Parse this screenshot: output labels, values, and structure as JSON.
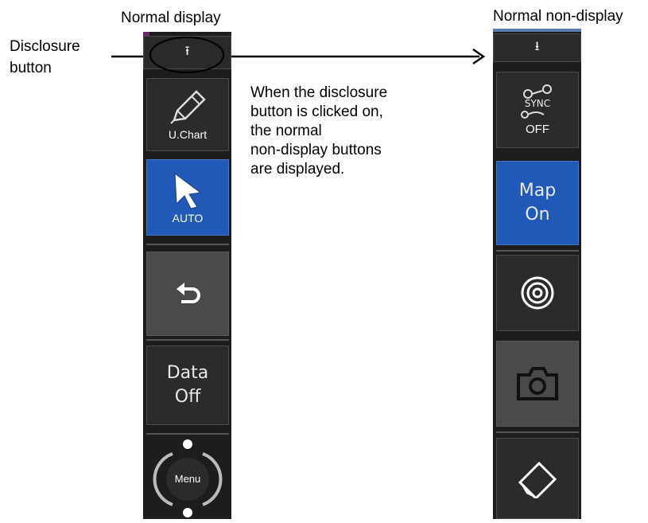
{
  "labels": {
    "normal_display": "Normal display",
    "normal_non_display": "Normal non-display",
    "disclosure_button_line1": "Disclosure",
    "disclosure_button_line2": "button",
    "note_lines": [
      "When the disclosure",
      "button is clicked on,",
      "the normal",
      "non-display buttons",
      "are displayed."
    ]
  },
  "left_panel": {
    "disclosure_glyph": "⭱",
    "uchart_label": "U.Chart",
    "auto_label": "AUTO",
    "data_line1": "Data",
    "data_line2": "Off",
    "menu_label": "Menu"
  },
  "right_panel": {
    "disclosure_glyph": "⭳",
    "sync_line1": "SYNC",
    "sync_line2": "OFF",
    "map_line1": "Map",
    "map_line2": "On"
  },
  "colors": {
    "panel_bg": "#1d1d1d",
    "button_bg": "#2b2b2b",
    "active_blue": "#2159b8",
    "pressed_grey": "#4a4a4a"
  },
  "icons": [
    "pencil-icon",
    "cursor-arrow-icon",
    "undo-icon",
    "sync-icon",
    "target-icon",
    "camera-icon",
    "eraser-icon"
  ]
}
